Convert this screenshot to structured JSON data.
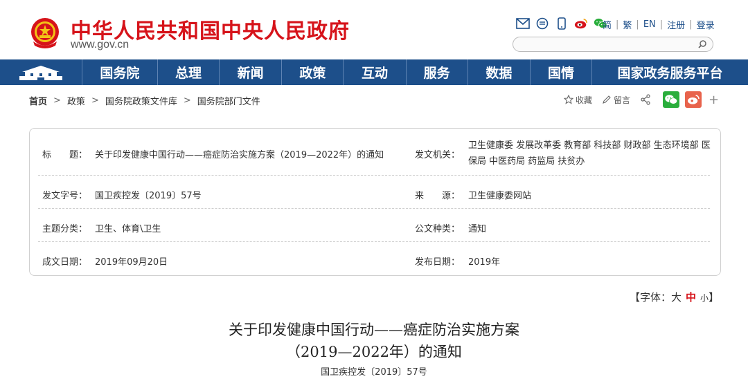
{
  "header": {
    "title": "中华人民共和国中央人民政府",
    "url": "www.gov.cn",
    "lang_links": [
      "简",
      "繁",
      "EN",
      "注册",
      "登录"
    ],
    "search_placeholder": ""
  },
  "nav": {
    "items": [
      "国务院",
      "总理",
      "新闻",
      "政策",
      "互动",
      "服务",
      "数据",
      "国情",
      "国家政务服务平台"
    ]
  },
  "breadcrumb": [
    "首页",
    "政策",
    "国务院政策文件库",
    "国务院部门文件"
  ],
  "share": {
    "favorite_label": "收藏",
    "comment_label": "留言"
  },
  "info": {
    "title_label": "标　　题：",
    "title_value": "关于印发健康中国行动——癌症防治实施方案（2019—2022年）的通知",
    "issuer_label": "发文机关：",
    "issuer_value": "卫生健康委 发展改革委 教育部 科技部 财政部 生态环境部 医保局 中医药局 药监局 扶贫办",
    "docno_label": "发文字号：",
    "docno_value": "国卫疾控发〔2019〕57号",
    "source_label": "来　　源：",
    "source_value": "卫生健康委网站",
    "topic_label": "主题分类：",
    "topic_value": "卫生、体育\\卫生",
    "type_label": "公文种类：",
    "type_value": "通知",
    "date_label": "成文日期：",
    "date_value": "2019年09月20日",
    "pub_label": "发布日期：",
    "pub_value": "2019年"
  },
  "fontsize": {
    "prefix": "【字体：",
    "large": "大",
    "medium": "中",
    "small": "小",
    "suffix": "】"
  },
  "article": {
    "title_line1": "关于印发健康中国行动——癌症防治实施方案",
    "title_line2": "（2019—2022年）的通知",
    "doc_number": "国卫疾控发〔2019〕57号"
  },
  "colors": {
    "brand_red": "#d6131a",
    "nav_blue": "#1d4f8a",
    "wechat_green": "#2aae3c",
    "weibo_red": "#e8634c"
  }
}
